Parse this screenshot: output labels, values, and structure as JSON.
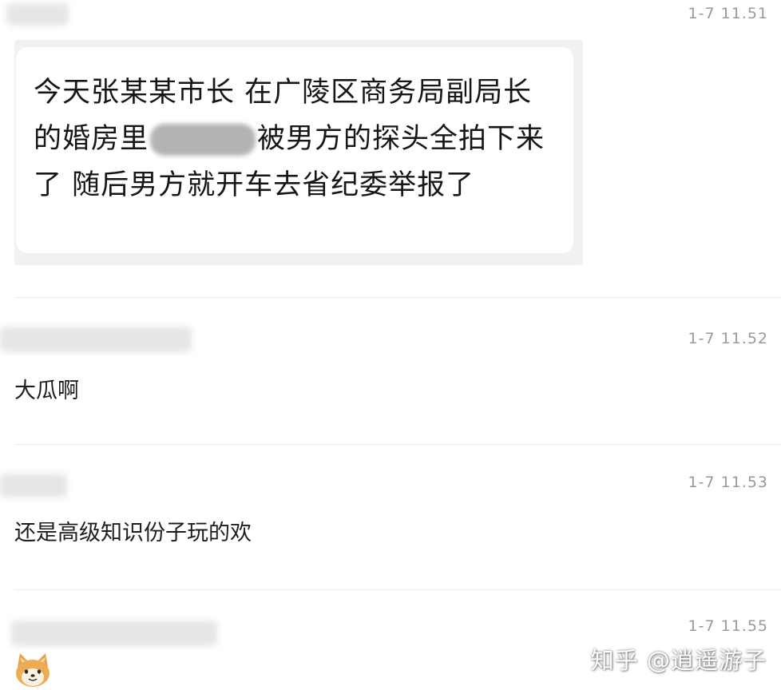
{
  "messages": [
    {
      "time": "1-7 11.51",
      "text_before": "今天张某某市长 在广陵区商务局副局长 的婚房里",
      "text_after": "被男方的探头全拍下来了 随后男方就开车去省纪委举报了"
    },
    {
      "time": "1-7 11.52",
      "text": "大瓜啊"
    },
    {
      "time": "1-7 11.53",
      "text": "还是高级知识份子玩的欢"
    },
    {
      "time": "1-7 11.55",
      "text": ""
    }
  ],
  "watermark": "知乎 @逍遥游子",
  "colors": {
    "background": "#ffffff",
    "bubble_bg": "#f0f1f3",
    "time_text": "#9a9a9a",
    "body_text": "#1d1d1d"
  },
  "icons": {
    "avatar": "shiba-dog-emoji-icon"
  }
}
